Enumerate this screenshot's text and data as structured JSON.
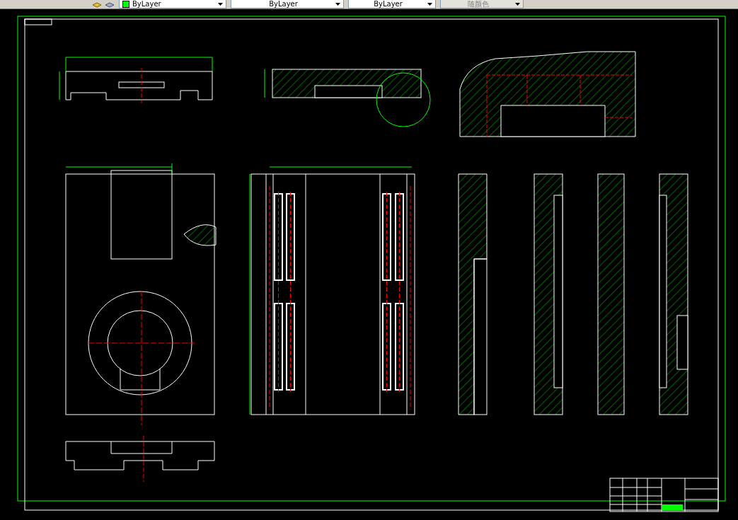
{
  "toolbar": {
    "dropdowns": [
      {
        "kind": "color",
        "value": "ByLayer",
        "color": "#00ff00",
        "disabled": false
      },
      {
        "kind": "plain",
        "value": "ByLayer",
        "disabled": false
      },
      {
        "kind": "plain",
        "value": "ByLayer",
        "disabled": false
      },
      {
        "kind": "plain",
        "value": "随颜色",
        "disabled": true
      }
    ]
  }
}
